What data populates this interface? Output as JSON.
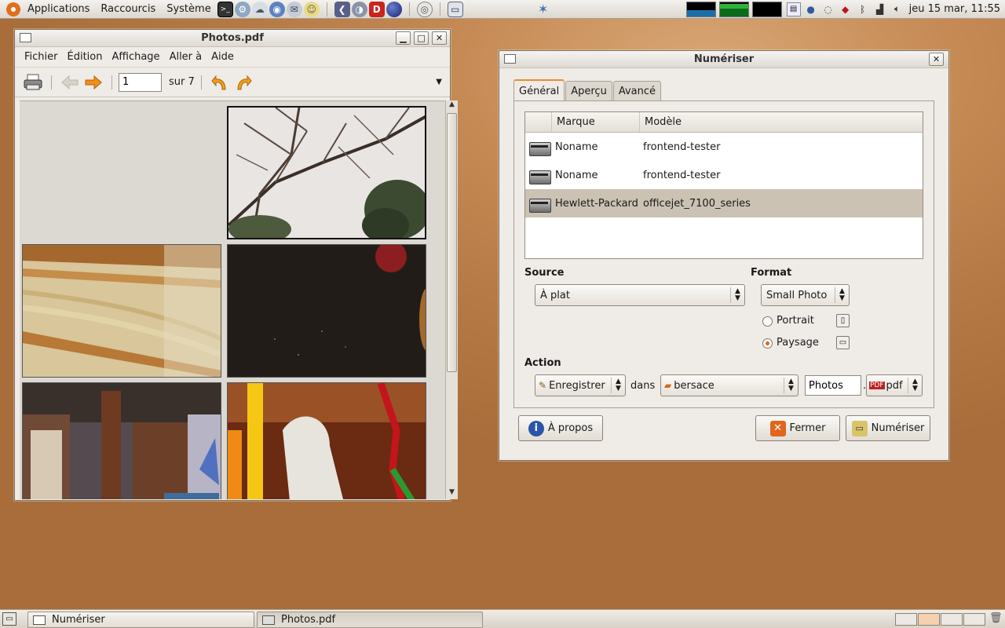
{
  "top_panel": {
    "menus": [
      "Applications",
      "Raccourcis",
      "Système"
    ],
    "clock": "jeu 15 mar, 11:55",
    "launcher_icons": [
      "terminal-icon",
      "network-icon",
      "weather-icon",
      "browser-icon",
      "mail-icon",
      "messenger-icon",
      "bookmarks-icon",
      "presentation-icon",
      "d-app-icon",
      "globe-icon",
      "cd-icon",
      "monitor-icon",
      "star-icon"
    ],
    "tray_icons": [
      "cpu-monitor-icon",
      "memory-monitor-icon",
      "network-monitor-icon",
      "calendar-icon",
      "globe-tray-icon",
      "wifi-tray-icon",
      "ruby-icon",
      "bluetooth-icon",
      "signal-icon",
      "volume-icon"
    ]
  },
  "photos_window": {
    "title": "Photos.pdf",
    "menu": [
      "Fichier",
      "Édition",
      "Affichage",
      "Aller à",
      "Aide"
    ],
    "page_entry_value": "1",
    "page_total": "sur 7"
  },
  "scan_dialog": {
    "title": "Numériser",
    "tabs": [
      "Général",
      "Aperçu",
      "Avancé"
    ],
    "device_list": {
      "headers": [
        "Marque",
        "Modèle"
      ],
      "rows": [
        {
          "brand": "Noname",
          "model": "frontend-tester"
        },
        {
          "brand": "Noname",
          "model": "frontend-tester"
        },
        {
          "brand": "Hewlett-Packard",
          "model": "officejet_7100_series"
        }
      ],
      "selected_index": 2
    },
    "source_label": "Source",
    "source_value": "À plat",
    "format_label": "Format",
    "format_value": "Small Photo",
    "orientation": {
      "portrait_label": "Portrait",
      "landscape_label": "Paysage",
      "selected": "Paysage"
    },
    "action_label": "Action",
    "action_value": "Enregistrer",
    "dans_label": "dans",
    "folder_value": "bersace",
    "filename_value": "Photos",
    "dot": ".",
    "extension_value": "pdf",
    "buttons": {
      "about": "À propos",
      "close": "Fermer",
      "scan": "Numériser"
    }
  },
  "taskbar": {
    "tasks": [
      "Numériser",
      "Photos.pdf"
    ]
  }
}
